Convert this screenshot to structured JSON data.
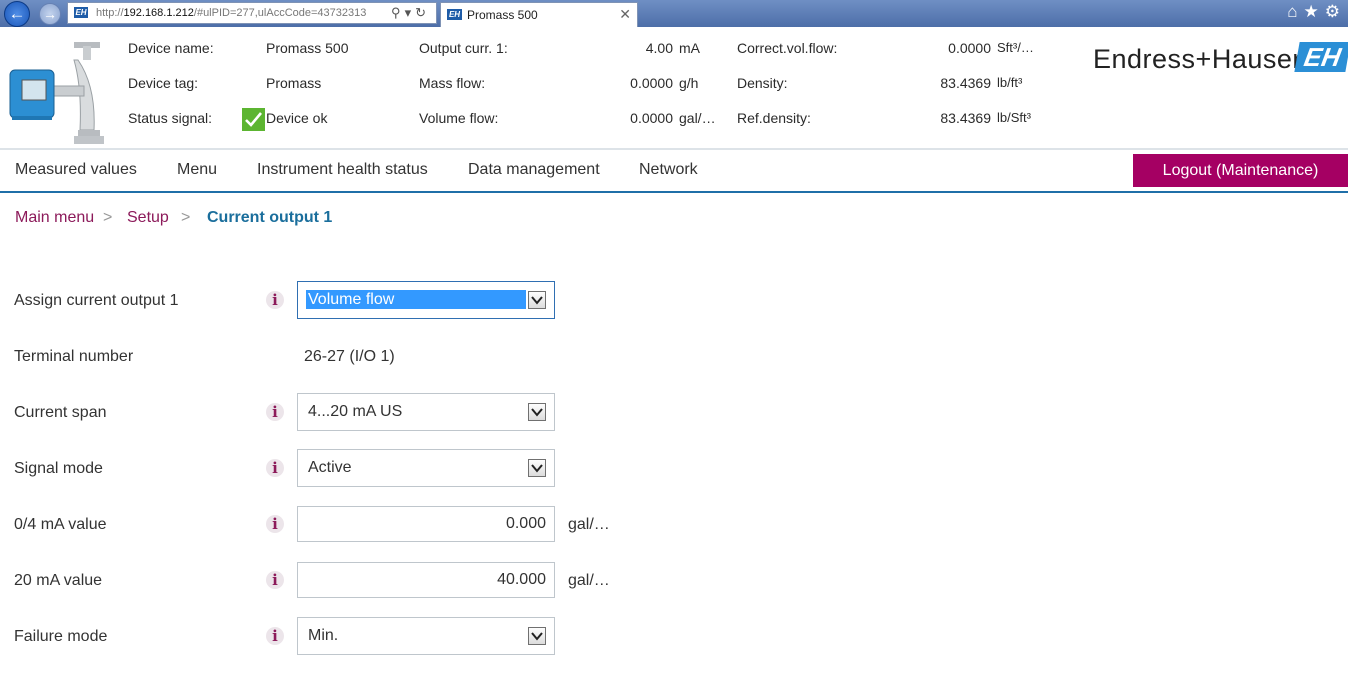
{
  "browser": {
    "url_host": "192.168.1.212",
    "url_prefix": "http://",
    "url_rest": "/#ulPID=277,ulAccCode=43732313",
    "tab_title": "Promass 500"
  },
  "header": {
    "device_name_label": "Device name:",
    "device_name": "Promass 500",
    "device_tag_label": "Device tag:",
    "device_tag": "Promass",
    "status_signal_label": "Status signal:",
    "status_signal": "Device ok",
    "output_curr_label": "Output curr. 1:",
    "output_curr_value": "4.00",
    "output_curr_unit": "mA",
    "mass_flow_label": "Mass flow:",
    "mass_flow_value": "0.0000",
    "mass_flow_unit": "g/h",
    "volume_flow_label": "Volume flow:",
    "volume_flow_value": "0.0000",
    "volume_flow_unit": "gal/…",
    "corr_vol_flow_label": "Correct.vol.flow:",
    "corr_vol_flow_value": "0.0000",
    "corr_vol_flow_unit": "Sft³/…",
    "density_label": "Density:",
    "density_value": "83.4369",
    "density_unit": "lb/ft³",
    "ref_density_label": "Ref.density:",
    "ref_density_value": "83.4369",
    "ref_density_unit": "lb/Sft³",
    "brand": "Endress+Hauser",
    "brand_mark": "EH"
  },
  "nav": {
    "items": [
      "Measured values",
      "Menu",
      "Instrument health status",
      "Data management",
      "Network"
    ],
    "logout": "Logout (Maintenance)"
  },
  "breadcrumb": {
    "main": "Main menu",
    "setup": "Setup",
    "current": "Current output 1",
    "sep": ">"
  },
  "form": {
    "assign": {
      "label": "Assign current output 1",
      "value": "Volume flow"
    },
    "terminal": {
      "label": "Terminal number",
      "value": "26-27 (I/O 1)"
    },
    "span": {
      "label": "Current span",
      "value": "4...20 mA US"
    },
    "signal_mode": {
      "label": "Signal mode",
      "value": "Active"
    },
    "ma_0_4": {
      "label": "0/4 mA value",
      "value": "0.000",
      "unit": "gal/…"
    },
    "ma_20": {
      "label": "20 mA value",
      "value": "40.000",
      "unit": "gal/…"
    },
    "failure_mode": {
      "label": "Failure mode",
      "value": "Min."
    },
    "info_glyph": "i"
  },
  "colors": {
    "accent_magenta": "#a50063",
    "accent_blue": "#1f6fa8",
    "status_ok": "#5cb531",
    "brand_blue": "#2b8fd6"
  }
}
